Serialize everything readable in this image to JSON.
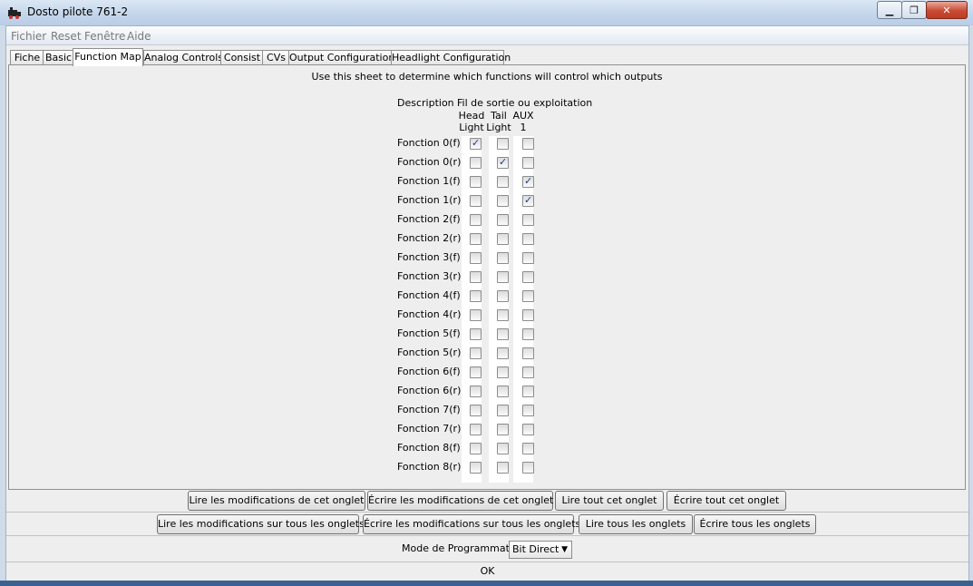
{
  "window": {
    "title": "Dosto pilote 761-2",
    "minimize_icon": "minimize-icon",
    "maximize_icon": "restore-icon",
    "close_icon": "close-icon"
  },
  "menu": [
    "Fichier",
    "Reset",
    "Fenêtre",
    "Aide"
  ],
  "tabs": [
    "Fiche",
    "Basic",
    "Function Map",
    "Analog Controls",
    "Consist",
    "CVs",
    "Output Configuration",
    "Headlight Configuration"
  ],
  "active_tab": "Function Map",
  "panel": {
    "instruction": "Use this sheet to determine which functions will control which outputs",
    "description_header": "Description",
    "outputs_header": "Fil de sortie ou exploitation",
    "columns": [
      {
        "line1": "Head",
        "line2": "Light"
      },
      {
        "line1": "Tail",
        "line2": "Light"
      },
      {
        "line1": "AUX",
        "line2": "1"
      }
    ],
    "rows": [
      {
        "label": "Fonction 0(f)",
        "checks": [
          true,
          false,
          false
        ]
      },
      {
        "label": "Fonction 0(r)",
        "checks": [
          false,
          true,
          false
        ]
      },
      {
        "label": "Fonction 1(f)",
        "checks": [
          false,
          false,
          true
        ]
      },
      {
        "label": "Fonction 1(r)",
        "checks": [
          false,
          false,
          true
        ]
      },
      {
        "label": "Fonction 2(f)",
        "checks": [
          false,
          false,
          false
        ]
      },
      {
        "label": "Fonction 2(r)",
        "checks": [
          false,
          false,
          false
        ]
      },
      {
        "label": "Fonction 3(f)",
        "checks": [
          false,
          false,
          false
        ]
      },
      {
        "label": "Fonction 3(r)",
        "checks": [
          false,
          false,
          false
        ]
      },
      {
        "label": "Fonction 4(f)",
        "checks": [
          false,
          false,
          false
        ]
      },
      {
        "label": "Fonction 4(r)",
        "checks": [
          false,
          false,
          false
        ]
      },
      {
        "label": "Fonction 5(f)",
        "checks": [
          false,
          false,
          false
        ]
      },
      {
        "label": "Fonction 5(r)",
        "checks": [
          false,
          false,
          false
        ]
      },
      {
        "label": "Fonction 6(f)",
        "checks": [
          false,
          false,
          false
        ]
      },
      {
        "label": "Fonction 6(r)",
        "checks": [
          false,
          false,
          false
        ]
      },
      {
        "label": "Fonction 7(f)",
        "checks": [
          false,
          false,
          false
        ]
      },
      {
        "label": "Fonction 7(r)",
        "checks": [
          false,
          false,
          false
        ]
      },
      {
        "label": "Fonction 8(f)",
        "checks": [
          false,
          false,
          false
        ]
      },
      {
        "label": "Fonction 8(r)",
        "checks": [
          false,
          false,
          false
        ]
      }
    ]
  },
  "buttons_tab": [
    "Lire les modifications de cet onglet",
    "Écrire les modifications de cet onglet",
    "Lire tout cet onglet",
    "Écrire tout cet onglet"
  ],
  "buttons_all": [
    "Lire les modifications sur tous les onglets",
    "Écrire les modifications sur tous les onglets",
    "Lire tous les onglets",
    "Écrire tous les onglets"
  ],
  "programming": {
    "label": "Mode de Programmation",
    "selected": "Bit Direct"
  },
  "status": "OK"
}
